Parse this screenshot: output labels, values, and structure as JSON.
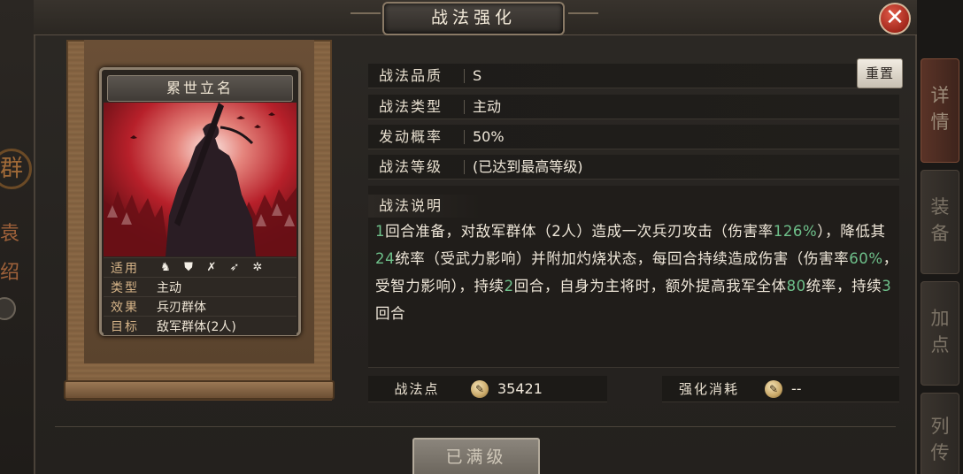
{
  "window": {
    "title": "战法强化",
    "close_symbol": "✕"
  },
  "background": {
    "left_chars": [
      "群",
      "袁",
      "绍"
    ]
  },
  "side_tabs": [
    {
      "label_lines": [
        "详",
        "情"
      ],
      "active": true
    },
    {
      "label_lines": [
        "装",
        "备"
      ],
      "active": false
    },
    {
      "label_lines": [
        "加",
        "点"
      ],
      "active": false
    },
    {
      "label_lines": [
        "列",
        "传"
      ],
      "active": false
    }
  ],
  "card": {
    "name": "累世立名",
    "art_icon": "warrior-silhouette",
    "rows": [
      {
        "key": "适用",
        "icons": [
          "cavalry-icon",
          "shield-icon",
          "bow-icon",
          "spear-icon",
          "wheel-icon"
        ]
      },
      {
        "key": "类型",
        "value": "主动"
      },
      {
        "key": "效果",
        "value": "兵刃群体"
      },
      {
        "key": "目标",
        "value": "敌军群体(2人)"
      }
    ]
  },
  "info": {
    "quality_label": "战法品质",
    "quality_value": "S",
    "type_label": "战法类型",
    "type_value": "主动",
    "rate_label": "发动概率",
    "rate_value": "50%",
    "level_label": "战法等级",
    "level_value": "(已达到最高等级)",
    "reset_label": "重置"
  },
  "description": {
    "heading": "战法说明",
    "segments": [
      {
        "t": "1",
        "g": true
      },
      {
        "t": "回合准备，对敌军群体（2人）造成一次兵刃攻击（伤害率",
        "g": false
      },
      {
        "t": "126%",
        "g": true
      },
      {
        "t": "），降低其",
        "g": false
      },
      {
        "t": "24",
        "g": true
      },
      {
        "t": "统率（受武力影响）并附加灼烧状态，每回合持续造成伤害（伤害率",
        "g": false
      },
      {
        "t": "60%",
        "g": true
      },
      {
        "t": "，受智力影响），持续",
        "g": false
      },
      {
        "t": "2",
        "g": true
      },
      {
        "t": "回合，自身为主将时，额外提高我军全体",
        "g": false
      },
      {
        "t": "80",
        "g": true
      },
      {
        "t": "统率，持续",
        "g": false
      },
      {
        "t": "3",
        "g": true
      },
      {
        "t": "回合",
        "g": false
      }
    ],
    "highlight_color": "#6ec08a"
  },
  "points": {
    "label": "战法点",
    "value": "35421",
    "coin_glyph": "✎"
  },
  "cost": {
    "label": "强化消耗",
    "value": "--",
    "coin_glyph": "✎"
  },
  "max_button": {
    "label": "已满级"
  }
}
